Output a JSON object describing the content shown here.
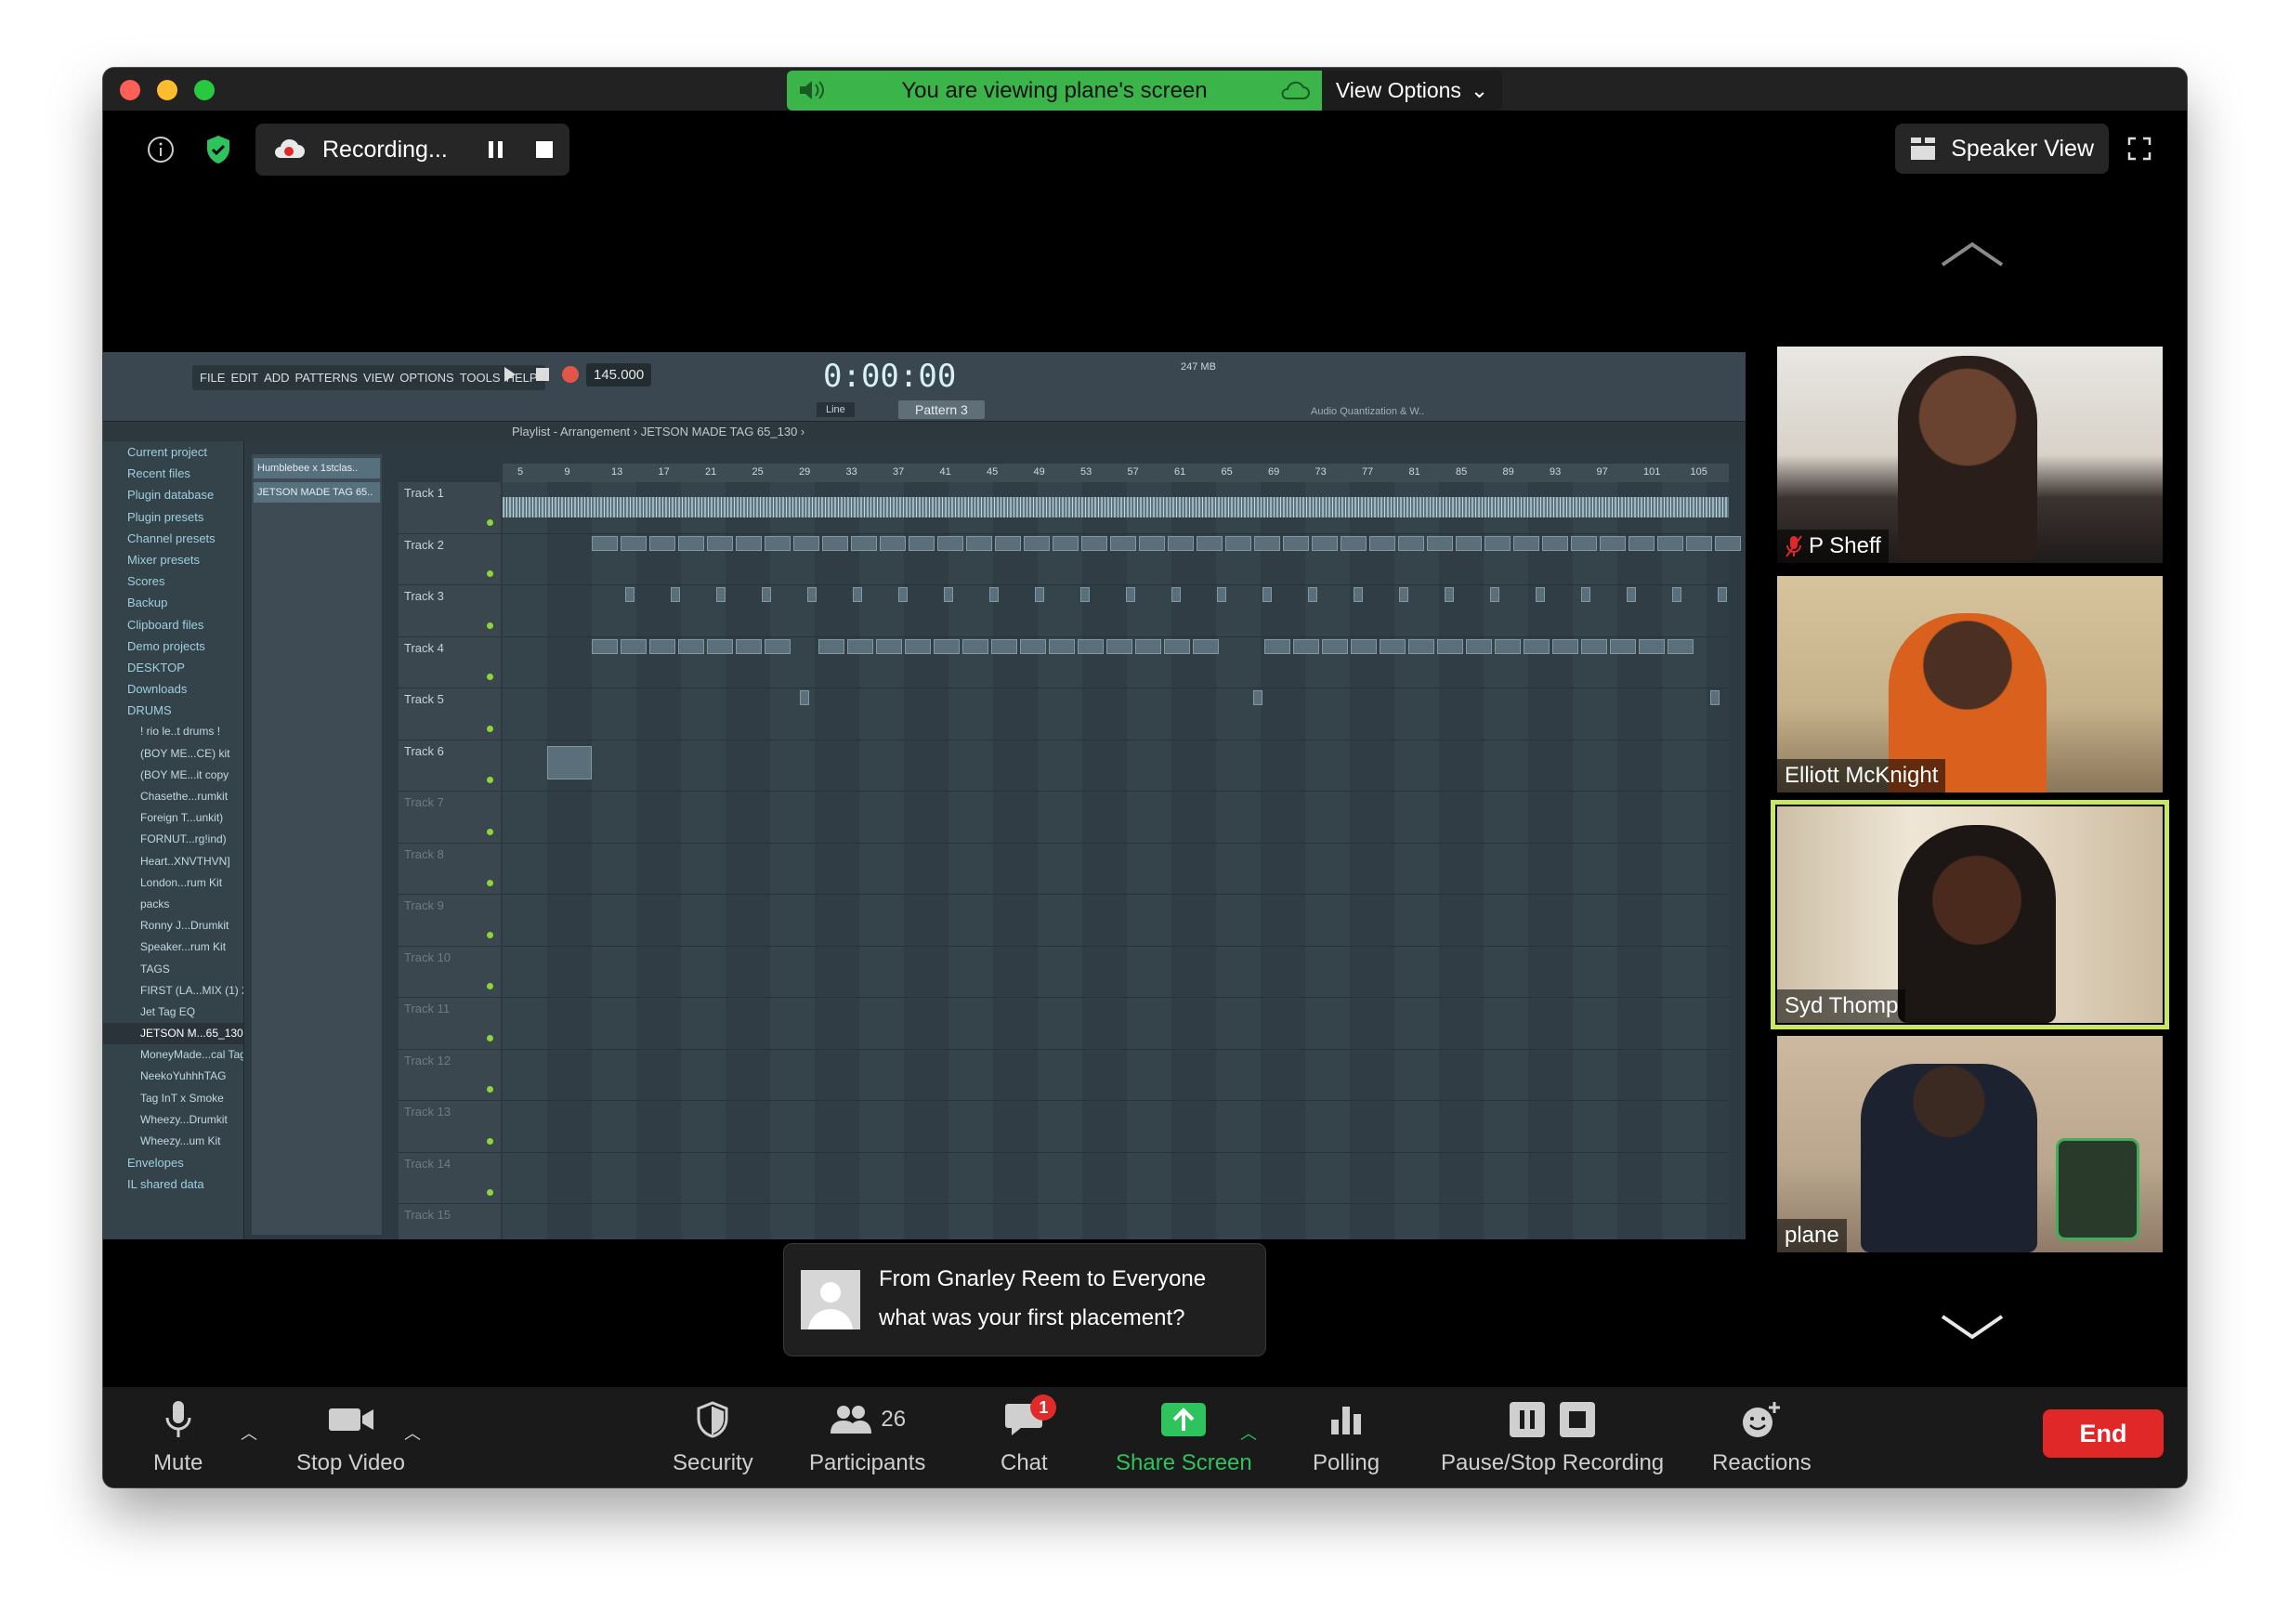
{
  "banner": {
    "viewing_text": "You are viewing plane's screen",
    "view_options_label": "View Options"
  },
  "top": {
    "recording_label": "Recording...",
    "speaker_view_label": "Speaker View"
  },
  "fl": {
    "menu": [
      "FILE",
      "EDIT",
      "ADD",
      "PATTERNS",
      "VIEW",
      "OPTIONS",
      "TOOLS",
      "HELP"
    ],
    "tempo": "145.000",
    "time": "0:00:00",
    "memory": "247 MB",
    "pattern": "Pattern 3",
    "snap": "Line",
    "playlist_title": "Playlist - Arrangement › JETSON MADE TAG 65_130 ›",
    "hint": "Audio Quantization & W..",
    "browser_items": [
      {
        "label": "Current project",
        "sub": false
      },
      {
        "label": "Recent files",
        "sub": false
      },
      {
        "label": "Plugin database",
        "sub": false
      },
      {
        "label": "Plugin presets",
        "sub": false
      },
      {
        "label": "Channel presets",
        "sub": false
      },
      {
        "label": "Mixer presets",
        "sub": false
      },
      {
        "label": "Scores",
        "sub": false
      },
      {
        "label": "Backup",
        "sub": false
      },
      {
        "label": "Clipboard files",
        "sub": false
      },
      {
        "label": "Demo projects",
        "sub": false
      },
      {
        "label": "DESKTOP",
        "sub": false
      },
      {
        "label": "Downloads",
        "sub": false
      },
      {
        "label": "DRUMS",
        "sub": false
      },
      {
        "label": "! rio le..t drums !",
        "sub": true
      },
      {
        "label": "(BOY ME...CE) kit",
        "sub": true
      },
      {
        "label": "(BOY ME...it copy",
        "sub": true
      },
      {
        "label": "Chasethe...rumkit",
        "sub": true
      },
      {
        "label": "Foreign T...unkit)",
        "sub": true
      },
      {
        "label": "FORNUT...rg!ind)",
        "sub": true
      },
      {
        "label": "Heart..XNVTHVN]",
        "sub": true
      },
      {
        "label": "London...rum Kit",
        "sub": true
      },
      {
        "label": "packs",
        "sub": true
      },
      {
        "label": "Ronny J...Drumkit",
        "sub": true
      },
      {
        "label": "Speaker...rum Kit",
        "sub": true
      },
      {
        "label": "TAGS",
        "sub": true
      },
      {
        "label": "FIRST (LA...MIX (1) 2",
        "sub": true
      },
      {
        "label": "Jet Tag EQ",
        "sub": true
      },
      {
        "label": "JETSON M...65_130",
        "sub": true
      },
      {
        "label": "MoneyMade...cal Tag",
        "sub": true
      },
      {
        "label": "NeekoYuhhhTAG",
        "sub": true
      },
      {
        "label": "Tag InT x Smoke",
        "sub": true
      },
      {
        "label": "Wheezy...Drumkit",
        "sub": true
      },
      {
        "label": "Wheezy...um Kit",
        "sub": true
      },
      {
        "label": "Envelopes",
        "sub": false
      },
      {
        "label": "IL shared data",
        "sub": false
      }
    ],
    "patterns": [
      "Humblebee x 1stclas..",
      "JETSON MADE TAG 65.."
    ],
    "tracks": [
      "Track 1",
      "Track 2",
      "Track 3",
      "Track 4",
      "Track 5",
      "Track 6",
      "Track 7",
      "Track 8",
      "Track 9",
      "Track 10",
      "Track 11",
      "Track 12",
      "Track 13",
      "Track 14",
      "Track 15"
    ],
    "ruler": [
      "5",
      "9",
      "13",
      "17",
      "21",
      "25",
      "29",
      "33",
      "37",
      "41",
      "45",
      "49",
      "53",
      "57",
      "61",
      "65",
      "69",
      "73",
      "77",
      "81",
      "85",
      "89",
      "93",
      "97",
      "101",
      "105"
    ]
  },
  "participants": [
    {
      "name": "P Sheff",
      "muted": true
    },
    {
      "name": "Elliott McKnight",
      "muted": false
    },
    {
      "name": "Syd Thomp",
      "muted": false,
      "active": true
    },
    {
      "name": "plane",
      "muted": false
    }
  ],
  "chat_popup": {
    "from": "From Gnarley Reem to Everyone",
    "message": "what was your first placement?"
  },
  "toolbar": {
    "mute": "Mute",
    "stop_video": "Stop Video",
    "security": "Security",
    "participants_count": "26",
    "participants": "Participants",
    "chat": "Chat",
    "chat_badge": "1",
    "share_screen": "Share Screen",
    "polling": "Polling",
    "pause_stop_recording": "Pause/Stop Recording",
    "reactions": "Reactions",
    "end": "End"
  },
  "colors": {
    "share_green": "#3bb54a",
    "active_speaker": "#c9e665",
    "end_red": "#e02828"
  }
}
